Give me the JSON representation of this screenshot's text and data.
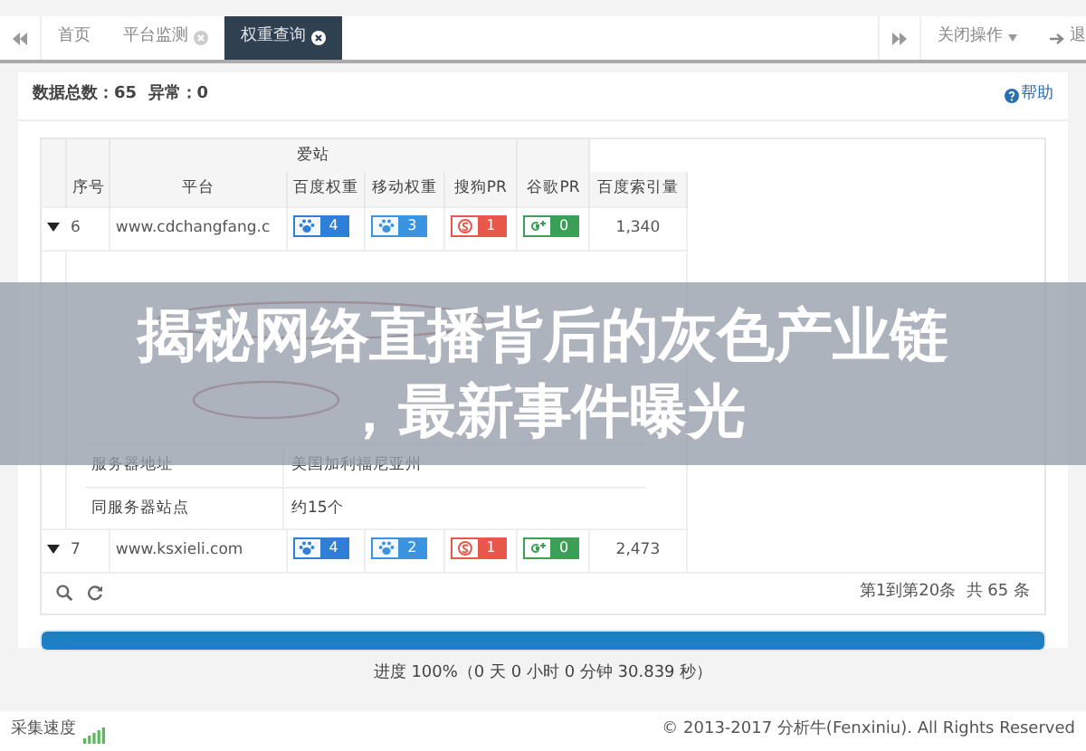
{
  "tabs": [
    {
      "label": "首页",
      "closable": false,
      "selected": false
    },
    {
      "label": "平台监测",
      "closable": true,
      "selected": false
    },
    {
      "label": "权重查询",
      "closable": true,
      "selected": true
    }
  ],
  "tab_actions": {
    "close_menu": "关闭操作",
    "logout": "退"
  },
  "summary": {
    "total_label": "数据总数：",
    "total": "65",
    "abnormal_label": "异常：",
    "abnormal": "0",
    "help": "帮助"
  },
  "table": {
    "group_header": "爱站",
    "columns": [
      "序号",
      "平台",
      "百度权重",
      "移动权重",
      "搜狗PR",
      "谷歌PR",
      "百度索引量"
    ],
    "rows": [
      {
        "index": "6",
        "platform": "www.cdchangfang.c",
        "expanded": true,
        "ranks": [
          {
            "kind": "baidu",
            "value": "4"
          },
          {
            "kind": "mobile",
            "value": "3"
          },
          {
            "kind": "sogou",
            "value": "1"
          },
          {
            "kind": "google",
            "value": "0"
          }
        ],
        "indexed": "1,340",
        "details": [
          {
            "name": "服务器地址",
            "content": "美国加利福尼亚州"
          },
          {
            "name": "同服务器站点",
            "content": "约15个"
          }
        ]
      },
      {
        "index": "7",
        "platform": "www.ksxieli.com",
        "expanded": true,
        "ranks": [
          {
            "kind": "baidu",
            "value": "4"
          },
          {
            "kind": "mobile",
            "value": "2"
          },
          {
            "kind": "sogou",
            "value": "1"
          },
          {
            "kind": "google",
            "value": "0"
          }
        ],
        "indexed": "2,473"
      }
    ],
    "pagination": {
      "range": "第1到第20条",
      "total": "共 65 条"
    }
  },
  "progress": {
    "level": 1,
    "text": "进度 100%（0 天 0 小时 0 分钟 30.839 秒）"
  },
  "status_bar": {
    "speed_label": "采集速度",
    "copyright": "© 2013-2017 分析牛(Fenxiniu). All Rights Reserved"
  },
  "banner": {
    "title": "揭秘网络直播背后的灰色产业链，最新事件曝光"
  }
}
